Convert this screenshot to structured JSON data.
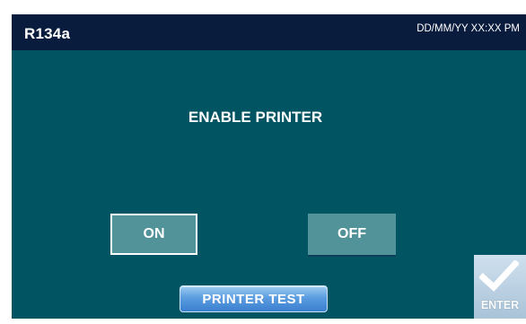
{
  "header": {
    "title": "R134a",
    "datetime": "DD/MM/YY XX:XX PM"
  },
  "main": {
    "title": "ENABLE PRINTER",
    "on_label": "ON",
    "off_label": "OFF",
    "printer_test_label": "PRINTER TEST",
    "enter_label": "ENTER",
    "selected": "ON"
  },
  "colors": {
    "background": "#015462",
    "header": "#0a1c3d",
    "toggle": "#52939a",
    "printer_test": "#4a8fd9",
    "enter": "#b8d0e3"
  },
  "icons": {
    "enter": "checkmark-icon"
  }
}
